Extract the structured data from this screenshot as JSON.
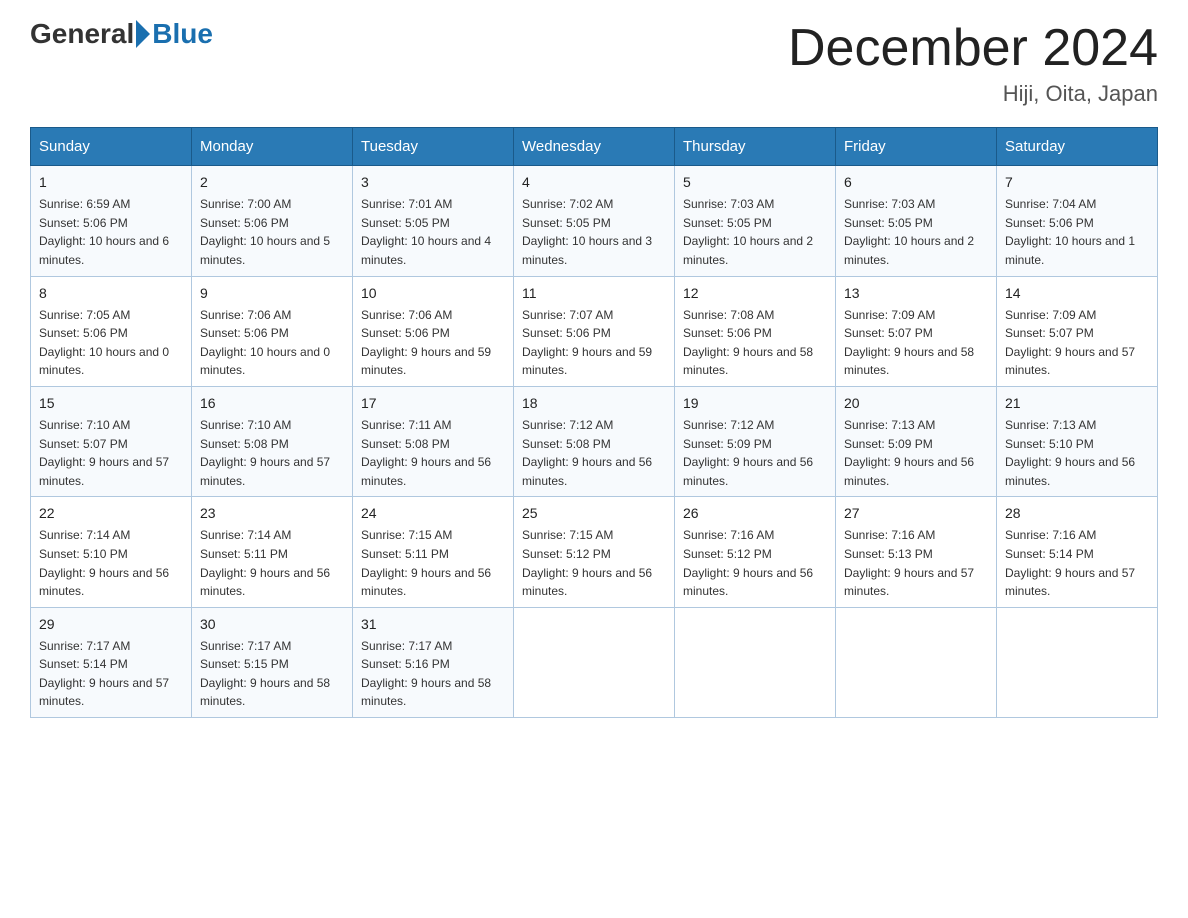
{
  "header": {
    "logo_general": "General",
    "logo_blue": "Blue",
    "month_title": "December 2024",
    "location": "Hiji, Oita, Japan"
  },
  "days_of_week": [
    "Sunday",
    "Monday",
    "Tuesday",
    "Wednesday",
    "Thursday",
    "Friday",
    "Saturday"
  ],
  "weeks": [
    [
      {
        "day": "1",
        "sunrise": "6:59 AM",
        "sunset": "5:06 PM",
        "daylight": "10 hours and 6 minutes."
      },
      {
        "day": "2",
        "sunrise": "7:00 AM",
        "sunset": "5:06 PM",
        "daylight": "10 hours and 5 minutes."
      },
      {
        "day": "3",
        "sunrise": "7:01 AM",
        "sunset": "5:05 PM",
        "daylight": "10 hours and 4 minutes."
      },
      {
        "day": "4",
        "sunrise": "7:02 AM",
        "sunset": "5:05 PM",
        "daylight": "10 hours and 3 minutes."
      },
      {
        "day": "5",
        "sunrise": "7:03 AM",
        "sunset": "5:05 PM",
        "daylight": "10 hours and 2 minutes."
      },
      {
        "day": "6",
        "sunrise": "7:03 AM",
        "sunset": "5:05 PM",
        "daylight": "10 hours and 2 minutes."
      },
      {
        "day": "7",
        "sunrise": "7:04 AM",
        "sunset": "5:06 PM",
        "daylight": "10 hours and 1 minute."
      }
    ],
    [
      {
        "day": "8",
        "sunrise": "7:05 AM",
        "sunset": "5:06 PM",
        "daylight": "10 hours and 0 minutes."
      },
      {
        "day": "9",
        "sunrise": "7:06 AM",
        "sunset": "5:06 PM",
        "daylight": "10 hours and 0 minutes."
      },
      {
        "day": "10",
        "sunrise": "7:06 AM",
        "sunset": "5:06 PM",
        "daylight": "9 hours and 59 minutes."
      },
      {
        "day": "11",
        "sunrise": "7:07 AM",
        "sunset": "5:06 PM",
        "daylight": "9 hours and 59 minutes."
      },
      {
        "day": "12",
        "sunrise": "7:08 AM",
        "sunset": "5:06 PM",
        "daylight": "9 hours and 58 minutes."
      },
      {
        "day": "13",
        "sunrise": "7:09 AM",
        "sunset": "5:07 PM",
        "daylight": "9 hours and 58 minutes."
      },
      {
        "day": "14",
        "sunrise": "7:09 AM",
        "sunset": "5:07 PM",
        "daylight": "9 hours and 57 minutes."
      }
    ],
    [
      {
        "day": "15",
        "sunrise": "7:10 AM",
        "sunset": "5:07 PM",
        "daylight": "9 hours and 57 minutes."
      },
      {
        "day": "16",
        "sunrise": "7:10 AM",
        "sunset": "5:08 PM",
        "daylight": "9 hours and 57 minutes."
      },
      {
        "day": "17",
        "sunrise": "7:11 AM",
        "sunset": "5:08 PM",
        "daylight": "9 hours and 56 minutes."
      },
      {
        "day": "18",
        "sunrise": "7:12 AM",
        "sunset": "5:08 PM",
        "daylight": "9 hours and 56 minutes."
      },
      {
        "day": "19",
        "sunrise": "7:12 AM",
        "sunset": "5:09 PM",
        "daylight": "9 hours and 56 minutes."
      },
      {
        "day": "20",
        "sunrise": "7:13 AM",
        "sunset": "5:09 PM",
        "daylight": "9 hours and 56 minutes."
      },
      {
        "day": "21",
        "sunrise": "7:13 AM",
        "sunset": "5:10 PM",
        "daylight": "9 hours and 56 minutes."
      }
    ],
    [
      {
        "day": "22",
        "sunrise": "7:14 AM",
        "sunset": "5:10 PM",
        "daylight": "9 hours and 56 minutes."
      },
      {
        "day": "23",
        "sunrise": "7:14 AM",
        "sunset": "5:11 PM",
        "daylight": "9 hours and 56 minutes."
      },
      {
        "day": "24",
        "sunrise": "7:15 AM",
        "sunset": "5:11 PM",
        "daylight": "9 hours and 56 minutes."
      },
      {
        "day": "25",
        "sunrise": "7:15 AM",
        "sunset": "5:12 PM",
        "daylight": "9 hours and 56 minutes."
      },
      {
        "day": "26",
        "sunrise": "7:16 AM",
        "sunset": "5:12 PM",
        "daylight": "9 hours and 56 minutes."
      },
      {
        "day": "27",
        "sunrise": "7:16 AM",
        "sunset": "5:13 PM",
        "daylight": "9 hours and 57 minutes."
      },
      {
        "day": "28",
        "sunrise": "7:16 AM",
        "sunset": "5:14 PM",
        "daylight": "9 hours and 57 minutes."
      }
    ],
    [
      {
        "day": "29",
        "sunrise": "7:17 AM",
        "sunset": "5:14 PM",
        "daylight": "9 hours and 57 minutes."
      },
      {
        "day": "30",
        "sunrise": "7:17 AM",
        "sunset": "5:15 PM",
        "daylight": "9 hours and 58 minutes."
      },
      {
        "day": "31",
        "sunrise": "7:17 AM",
        "sunset": "5:16 PM",
        "daylight": "9 hours and 58 minutes."
      },
      null,
      null,
      null,
      null
    ]
  ],
  "labels": {
    "sunrise": "Sunrise:",
    "sunset": "Sunset:",
    "daylight": "Daylight:"
  }
}
